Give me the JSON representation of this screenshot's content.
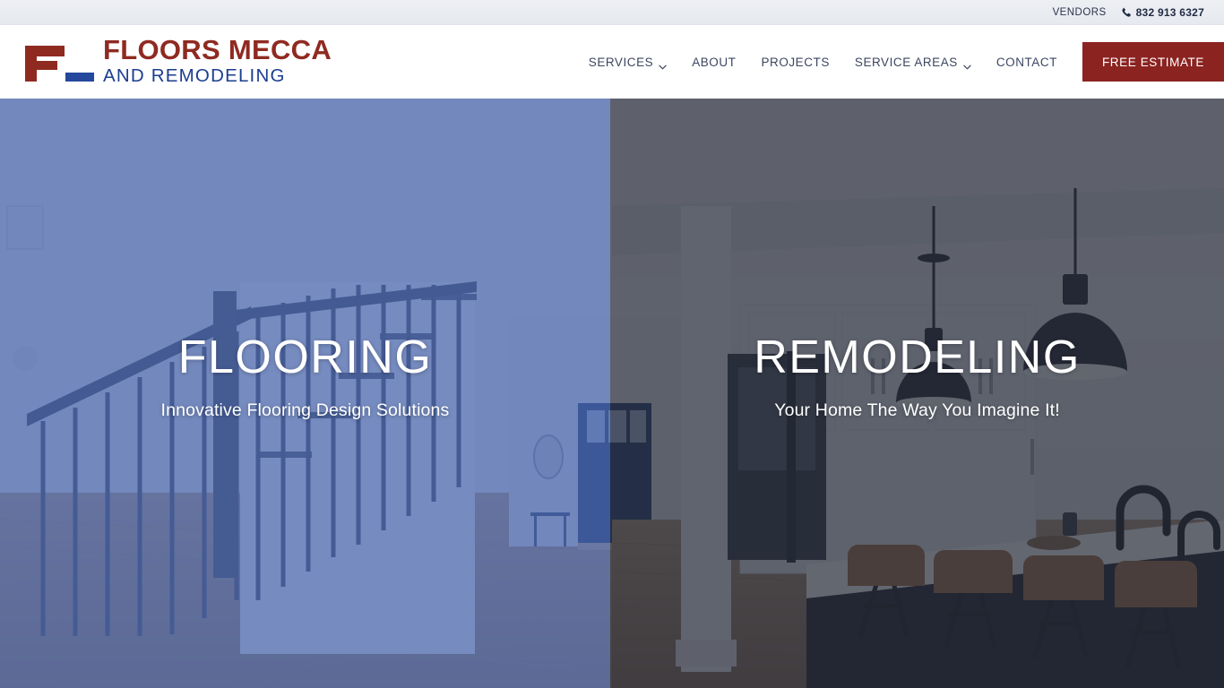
{
  "topbar": {
    "vendors_label": "VENDORS",
    "phone_icon": "phone-icon",
    "phone_number": "832 913 6327"
  },
  "header": {
    "logo": {
      "mark_icon": "floors-mecca-f-mark-icon",
      "name_top": "FLOORS MECCA",
      "name_bottom": "AND REMODELING",
      "red": "#8f2a21",
      "blue": "#1b3e8f"
    },
    "nav": [
      {
        "label": "SERVICES",
        "has_caret": true,
        "caret_icon": "chevron-down-icon"
      },
      {
        "label": "ABOUT",
        "has_caret": false
      },
      {
        "label": "PROJECTS",
        "has_caret": false
      },
      {
        "label": "SERVICE AREAS",
        "has_caret": true,
        "caret_icon": "chevron-down-icon"
      },
      {
        "label": "CONTACT",
        "has_caret": false
      }
    ],
    "cta_label": "FREE ESTIMATE",
    "cta_color": "#8b2320"
  },
  "hero": {
    "left": {
      "title": "FLOORING",
      "subtitle": "Innovative Flooring Design Solutions",
      "overlay_color": "#4864aa"
    },
    "right": {
      "title": "REMODELING",
      "subtitle": "Your Home The Way You Imagine It!",
      "overlay_color": "#262b38"
    }
  }
}
